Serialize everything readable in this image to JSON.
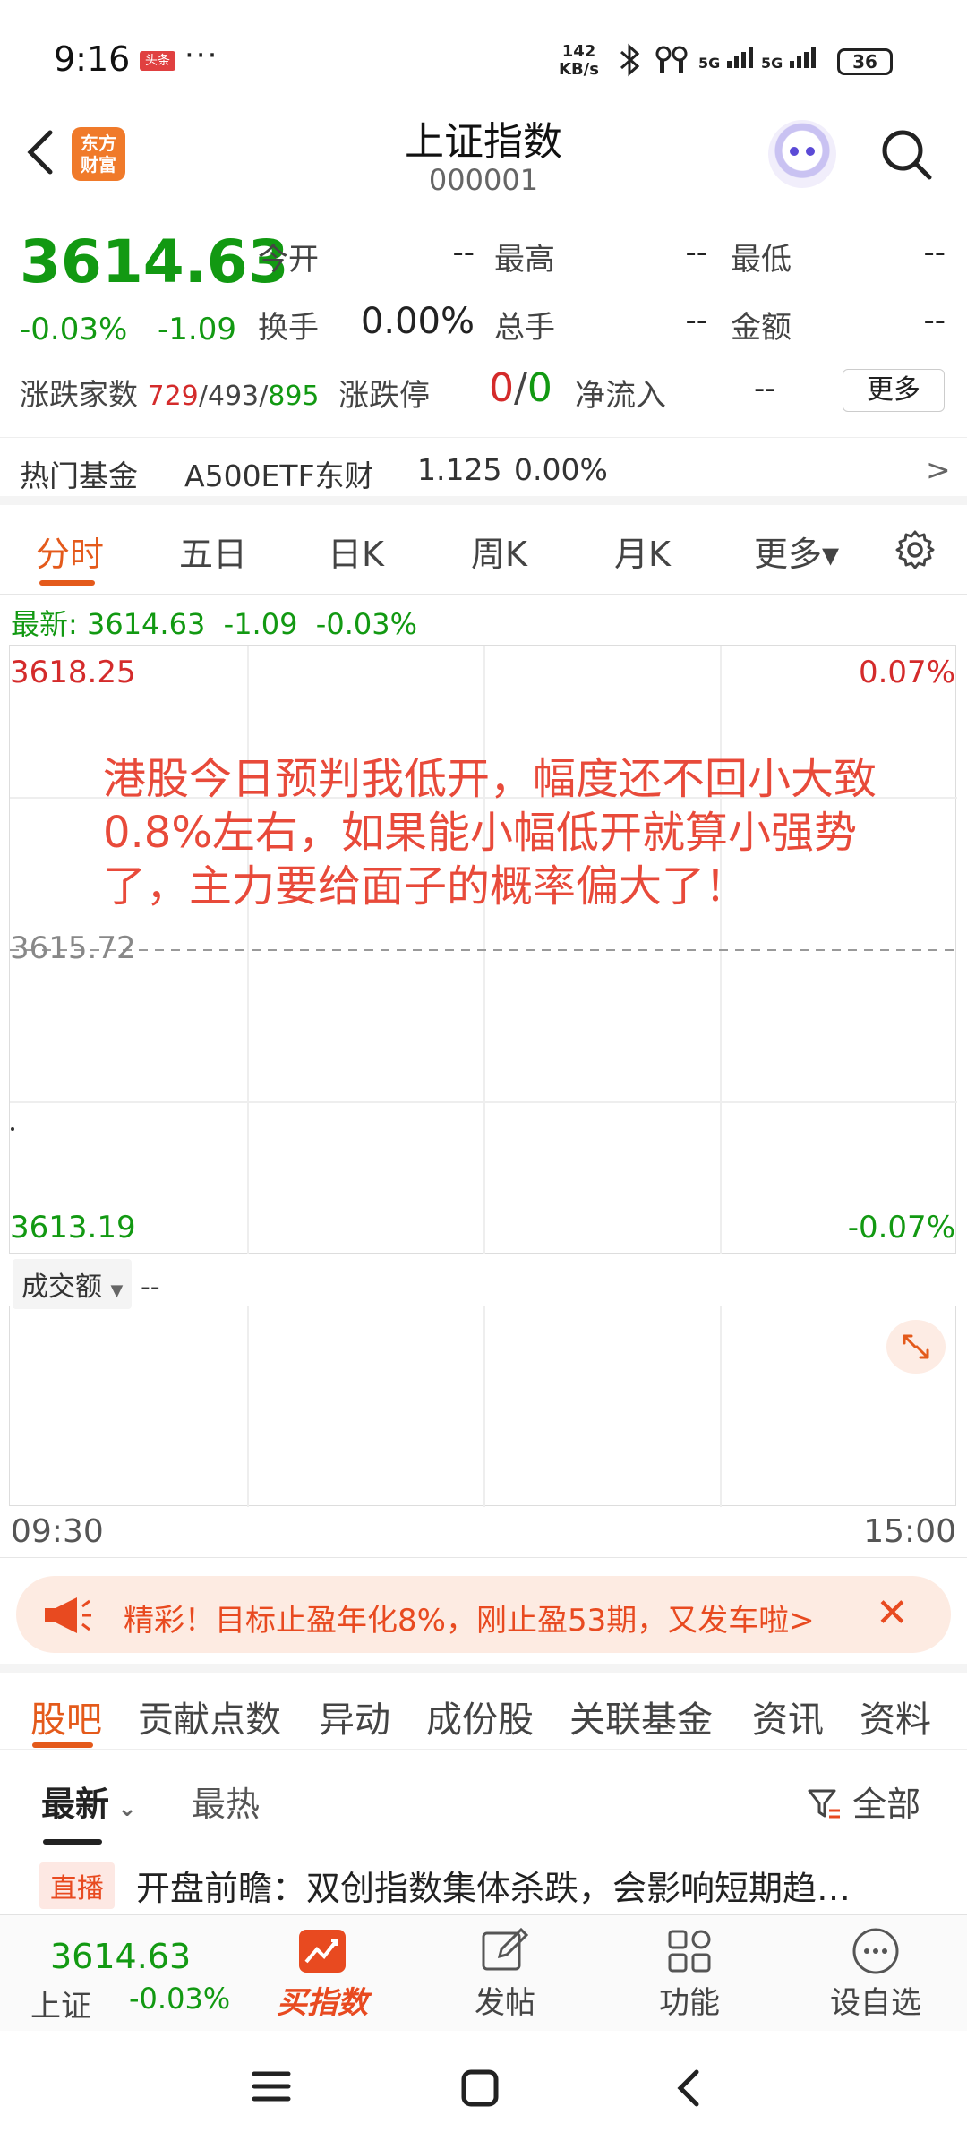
{
  "status_bar": {
    "time": "9:16",
    "notif_badge": "头条",
    "dots": "···",
    "net_speed_value": "142",
    "net_speed_unit": "KB/s",
    "sim1": "5G",
    "sim2": "5G",
    "battery": "36"
  },
  "header": {
    "back_icon": "chevron-left-icon",
    "logo_line1": "东方",
    "logo_line2": "财富",
    "title": "上证指数",
    "code": "000001"
  },
  "quote": {
    "price": "3614.63",
    "change_pct": "-0.03%",
    "change_abs": "-1.09",
    "open_label": "今开",
    "open_value": "--",
    "high_label": "最高",
    "high_value": "--",
    "low_label": "最低",
    "low_value": "--",
    "turnover_label": "换手",
    "turnover_value": "0.00%",
    "volume_label": "总手",
    "volume_value": "--",
    "amount_label": "金额",
    "amount_value": "--",
    "counts_label": "涨跌家数",
    "up_count": "729",
    "flat_count": "493",
    "down_count": "895",
    "sep": "/",
    "limit_label": "涨跌停",
    "limit_up": "0",
    "limit_down": "0",
    "netflow_label": "净流入",
    "netflow_value": "--",
    "more_button": "更多"
  },
  "hot_fund": {
    "label": "热门基金",
    "name": "A500ETF东财",
    "price": "1.125",
    "change": "0.00%",
    "arrow": ">"
  },
  "period_tabs": [
    "分时",
    "五日",
    "日K",
    "周K",
    "月K",
    "更多▾"
  ],
  "latest": {
    "label": "最新:",
    "price": "3614.63",
    "change": "-1.09",
    "pct": "-0.03%"
  },
  "chart": {
    "y_top": "3618.25",
    "y_mid": "3615.72",
    "y_bottom": "3613.19",
    "pct_top": "0.07%",
    "pct_bottom": "-0.07%",
    "annotation": "港股今日预判我低开，幅度还不回小大致0.8%左右，如果能小幅低开就算小强势了，主力要给面子的概率偏大了！"
  },
  "volume": {
    "selector": "成交额",
    "value": "--",
    "time_start": "09:30",
    "time_end": "15:00"
  },
  "promo": {
    "text": "精彩！目标止盈年化8%，刚止盈53期，又发车啦>",
    "close": "✕"
  },
  "news_tabs": [
    "股吧",
    "贡献点数",
    "异动",
    "成份股",
    "关联基金",
    "资讯",
    "资料"
  ],
  "sub_tabs": {
    "latest": "最新",
    "hottest": "最热",
    "filter": "全部"
  },
  "news_item": {
    "tag": "直播",
    "headline": "开盘前瞻：双创指数集体杀跌，会影响短期趋…"
  },
  "toolbar": {
    "price": "3614.63",
    "name": "上证",
    "change": "-0.03%",
    "buttons": [
      "买指数",
      "发帖",
      "功能",
      "设自选"
    ]
  },
  "colors": {
    "accent": "#e45a1b",
    "down_green": "#129912",
    "up_red": "#d42b2b",
    "annotation_red": "#e84a3a"
  }
}
